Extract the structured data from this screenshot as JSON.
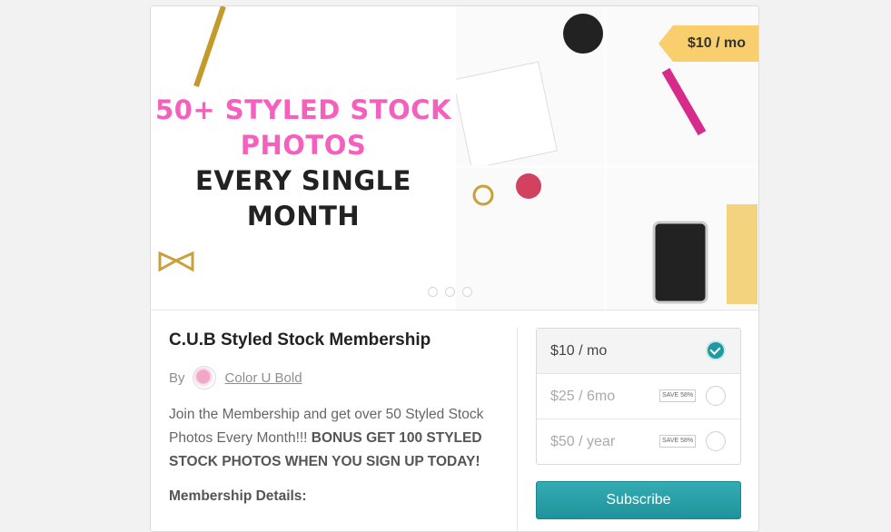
{
  "hero": {
    "line1": "50+ STYLED STOCK",
    "line2": "PHOTOS",
    "line3": "EVERY SINGLE",
    "line4": "MONTH",
    "price_tag": "$10 / mo"
  },
  "product": {
    "title": "C.U.B Styled Stock Membership",
    "by_label": "By",
    "author": "Color U Bold",
    "description_plain": "Join the Membership and get over 50 Styled Stock Photos Every Month!!! ",
    "description_bold": "BONUS GET 100 STYLED STOCK PHOTOS WHEN YOU SIGN UP TODAY!",
    "details_heading": "Membership Details:"
  },
  "plans": [
    {
      "label": "$10 / mo",
      "selected": true,
      "save": ""
    },
    {
      "label": "$25 / 6mo",
      "selected": false,
      "save": "SAVE 58%"
    },
    {
      "label": "$50 / year",
      "selected": false,
      "save": "SAVE 58%"
    }
  ],
  "subscribe_label": "Subscribe",
  "colors": {
    "accent": "#1e9aa3",
    "pink": "#f55fbe",
    "gold": "#f9cf6d"
  }
}
